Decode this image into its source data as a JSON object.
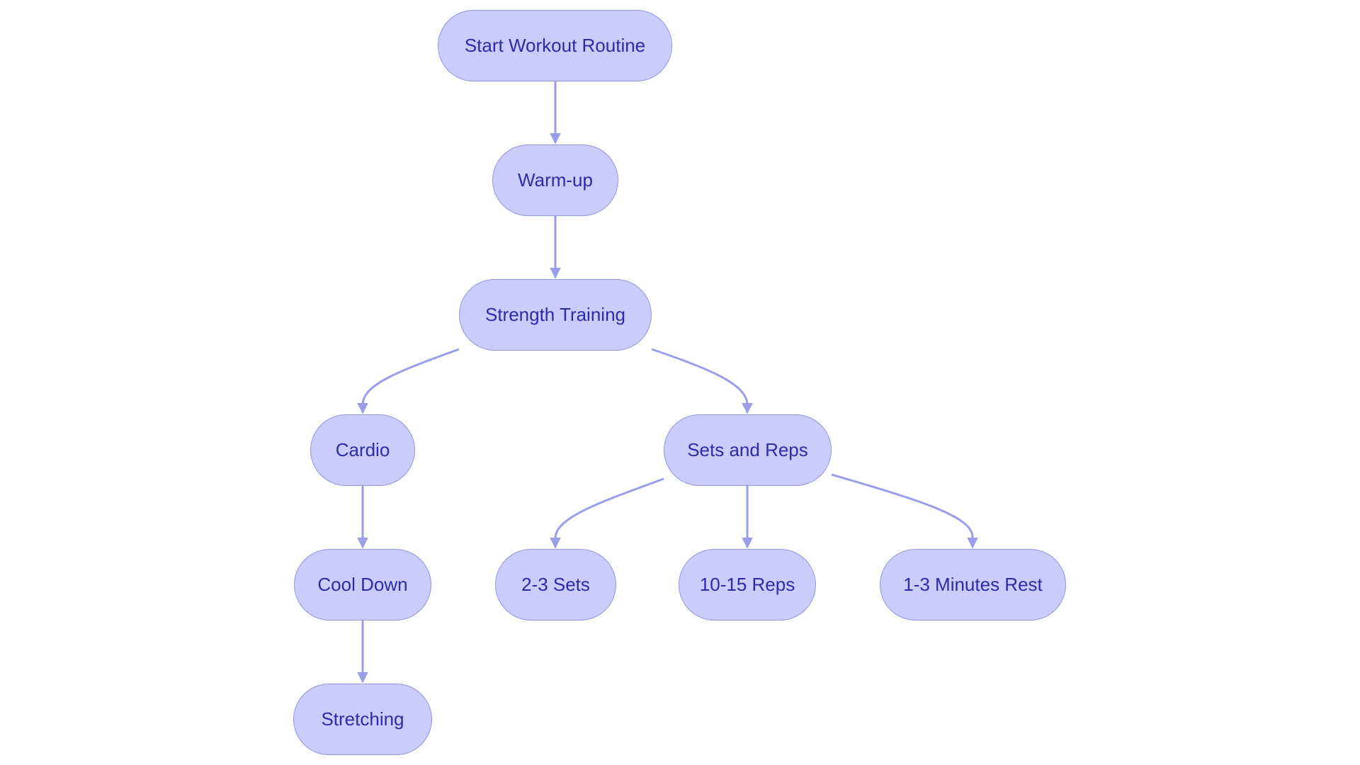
{
  "diagram": {
    "type": "flowchart",
    "direction": "top-down",
    "colors": {
      "node_fill": "#cbcbfc",
      "node_border": "#9396e0",
      "node_text": "#2c2ca8",
      "edge": "#9a9eea",
      "background": "#ffffff"
    },
    "nodes": [
      {
        "id": "start",
        "label": "Start Workout Routine"
      },
      {
        "id": "warmup",
        "label": "Warm-up"
      },
      {
        "id": "strength",
        "label": "Strength Training"
      },
      {
        "id": "cardio",
        "label": "Cardio"
      },
      {
        "id": "sets_reps",
        "label": "Sets and Reps"
      },
      {
        "id": "cooldown",
        "label": "Cool Down"
      },
      {
        "id": "stretching",
        "label": "Stretching"
      },
      {
        "id": "sets",
        "label": "2-3 Sets"
      },
      {
        "id": "reps",
        "label": "10-15 Reps"
      },
      {
        "id": "rest",
        "label": "1-3 Minutes Rest"
      }
    ],
    "edges": [
      {
        "from": "start",
        "to": "warmup"
      },
      {
        "from": "warmup",
        "to": "strength"
      },
      {
        "from": "strength",
        "to": "cardio"
      },
      {
        "from": "strength",
        "to": "sets_reps"
      },
      {
        "from": "cardio",
        "to": "cooldown"
      },
      {
        "from": "cooldown",
        "to": "stretching"
      },
      {
        "from": "sets_reps",
        "to": "sets"
      },
      {
        "from": "sets_reps",
        "to": "reps"
      },
      {
        "from": "sets_reps",
        "to": "rest"
      }
    ]
  }
}
